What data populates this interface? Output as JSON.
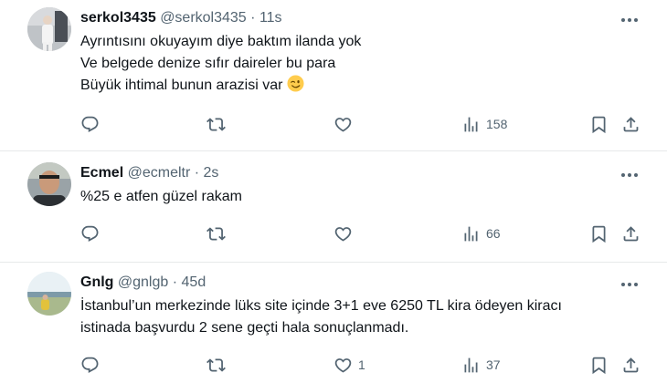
{
  "tweets": [
    {
      "name": "serkol3435",
      "handle": "@serkol3435",
      "sep": "·",
      "time": "11s",
      "lines": [
        "Ayrıntısını okuyayım diye baktım ilanda yok",
        "Ve belgede denize sıfır daireler bu para",
        "Büyük ihtimal bunun arazisi var"
      ],
      "emoji": "wink-emoji",
      "likes": "",
      "views": "158"
    },
    {
      "name": "Ecmel",
      "handle": "@ecmeltr",
      "sep": "·",
      "time": "2s",
      "lines": [
        "%25 e atfen güzel rakam"
      ],
      "likes": "",
      "views": "66"
    },
    {
      "name": "Gnlg",
      "handle": "@gnlgb",
      "sep": "·",
      "time": "45d",
      "lines": [
        "İstanbul’un merkezinde lüks site içinde 3+1 eve 6250 TL kira ödeyen kiracı",
        "istinada başvurdu 2 sene geçti hala sonuçlanmadı."
      ],
      "likes": "1",
      "views": "37"
    }
  ],
  "icons": {
    "reply": "reply-icon",
    "retweet": "retweet-icon",
    "like": "like-icon",
    "views": "views-icon",
    "bookmark": "bookmark-icon",
    "share": "share-icon",
    "more": "more-icon"
  },
  "colors": {
    "text": "#0f1419",
    "secondary": "#536471",
    "divider": "#e7e9ea"
  }
}
